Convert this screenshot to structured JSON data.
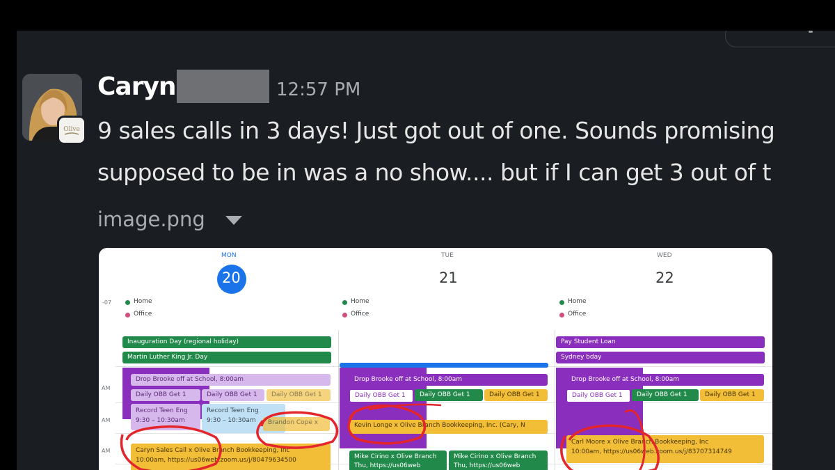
{
  "message": {
    "sender": "Caryn",
    "time": "12:57 PM",
    "lines": [
      "9 sales calls in 3 days! Just got out of one. Sounds promising",
      "supposed to be in was a no show.... but if I can get 3 out of t"
    ],
    "attachment": {
      "filename": "image.png",
      "dropdown_icon": "caret-down-icon"
    }
  },
  "calendar": {
    "timezone": "-07",
    "days": [
      {
        "name": "MON",
        "date": "20",
        "today": true
      },
      {
        "name": "TUE",
        "date": "21",
        "today": false
      },
      {
        "name": "WED",
        "date": "22",
        "today": false
      }
    ],
    "working_locations": [
      "Home",
      "Office"
    ],
    "allday": {
      "mon": [
        "Inauguration Day (regional holiday)",
        "Martin Luther King Jr. Day"
      ],
      "wed": [
        "Pay Student Loan",
        "Sydney bday"
      ]
    },
    "hour_labels": [
      "AM",
      "AM",
      "AM"
    ],
    "events": {
      "mon": [
        "Drop Brooke off at School, 8:00am",
        "Daily OBB Get 1",
        "Daily OBB Get 1",
        "Daily OBB Get 1",
        "Record Teen Eng",
        "9:30 – 10:30am",
        "Record Teen Eng",
        "9:30 – 10:30am",
        "Brandon Cope x",
        "Caryn Sales Call x Olive Branch Bookkeeping, Inc",
        "10:00am, https://us06web.zoom.us/j/80479634500"
      ],
      "tue": [
        "Drop Brooke off at School, 8:00am",
        "Daily OBB Get 1",
        "Daily OBB Get 1",
        "Daily OBB Get 1",
        "Kevin Longe x Olive Branch Bookkeeping, Inc. (Cary, N",
        "Mike Cirino x Olive Branch",
        "Mike Cirino x Olive Branch",
        "Thu, https://us06web",
        "Thu, https://us06web"
      ],
      "wed": [
        "Drop Brooke off at School, 8:00am",
        "Daily OBB Get 1",
        "Daily OBB Get 1",
        "Daily OBB Get 1",
        "Carl Moore x Olive Branch Bookkeeping, Inc",
        "10:00am, https://us06web.zoom.us/j/83707314749"
      ]
    }
  },
  "colors": {
    "background": "#1a1d21",
    "today": "#1a73e8",
    "green": "#218a4a",
    "purple": "#8a2ebe",
    "yellow": "#f2be38",
    "annotation": "#e3262c"
  }
}
